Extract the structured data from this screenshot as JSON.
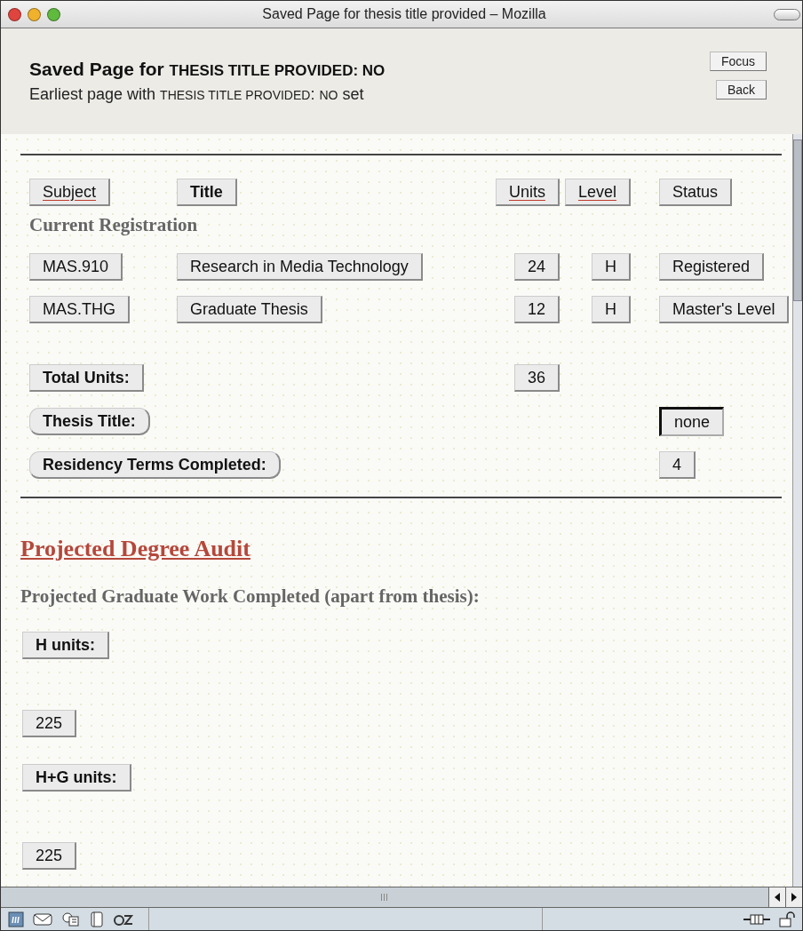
{
  "window": {
    "title": "Saved Page for thesis title provided – Mozilla"
  },
  "header": {
    "heading": {
      "lead": "Saved Page for",
      "field": "THESIS TITLE PROVIDED: NO"
    },
    "subheading": {
      "lead": "Earliest page with",
      "field": "THESIS TITLE PROVIDED",
      "separator": ":",
      "value": "NO",
      "tail": "set"
    },
    "buttons": [
      "Focus",
      "Back"
    ]
  },
  "columns": [
    {
      "label": "Subject",
      "underlined": true,
      "bold": false
    },
    {
      "label": "Title",
      "underlined": false,
      "bold": true
    },
    {
      "label": "Units",
      "underlined": true,
      "bold": false
    },
    {
      "label": "Level",
      "underlined": true,
      "bold": false
    },
    {
      "label": "Status",
      "underlined": false,
      "bold": false
    }
  ],
  "section_title": "Current Registration",
  "rows": [
    {
      "cells": [
        "MAS.910",
        "Research in Media Technology",
        "24",
        "H",
        "Registered"
      ]
    },
    {
      "cells": [
        "MAS.THG",
        "Graduate Thesis",
        "12",
        "H",
        "Master's Level"
      ]
    }
  ],
  "summary": [
    {
      "label": "Total Units:",
      "rounded": false,
      "value": "36",
      "kind": "units",
      "pressed": false
    },
    {
      "label": "Thesis Title:",
      "rounded": true,
      "value": "none",
      "kind": "status",
      "pressed": true
    },
    {
      "label": "Residency Terms Completed:",
      "rounded": true,
      "value": "4",
      "kind": "status",
      "pressed": false
    }
  ],
  "audit": {
    "title": "Projected Degree Audit",
    "subtitle": "Projected Graduate Work Completed (apart from thesis):",
    "blocks": [
      {
        "label": "H units:",
        "value": "225"
      },
      {
        "label": "H+G units:",
        "value": "225"
      }
    ]
  }
}
